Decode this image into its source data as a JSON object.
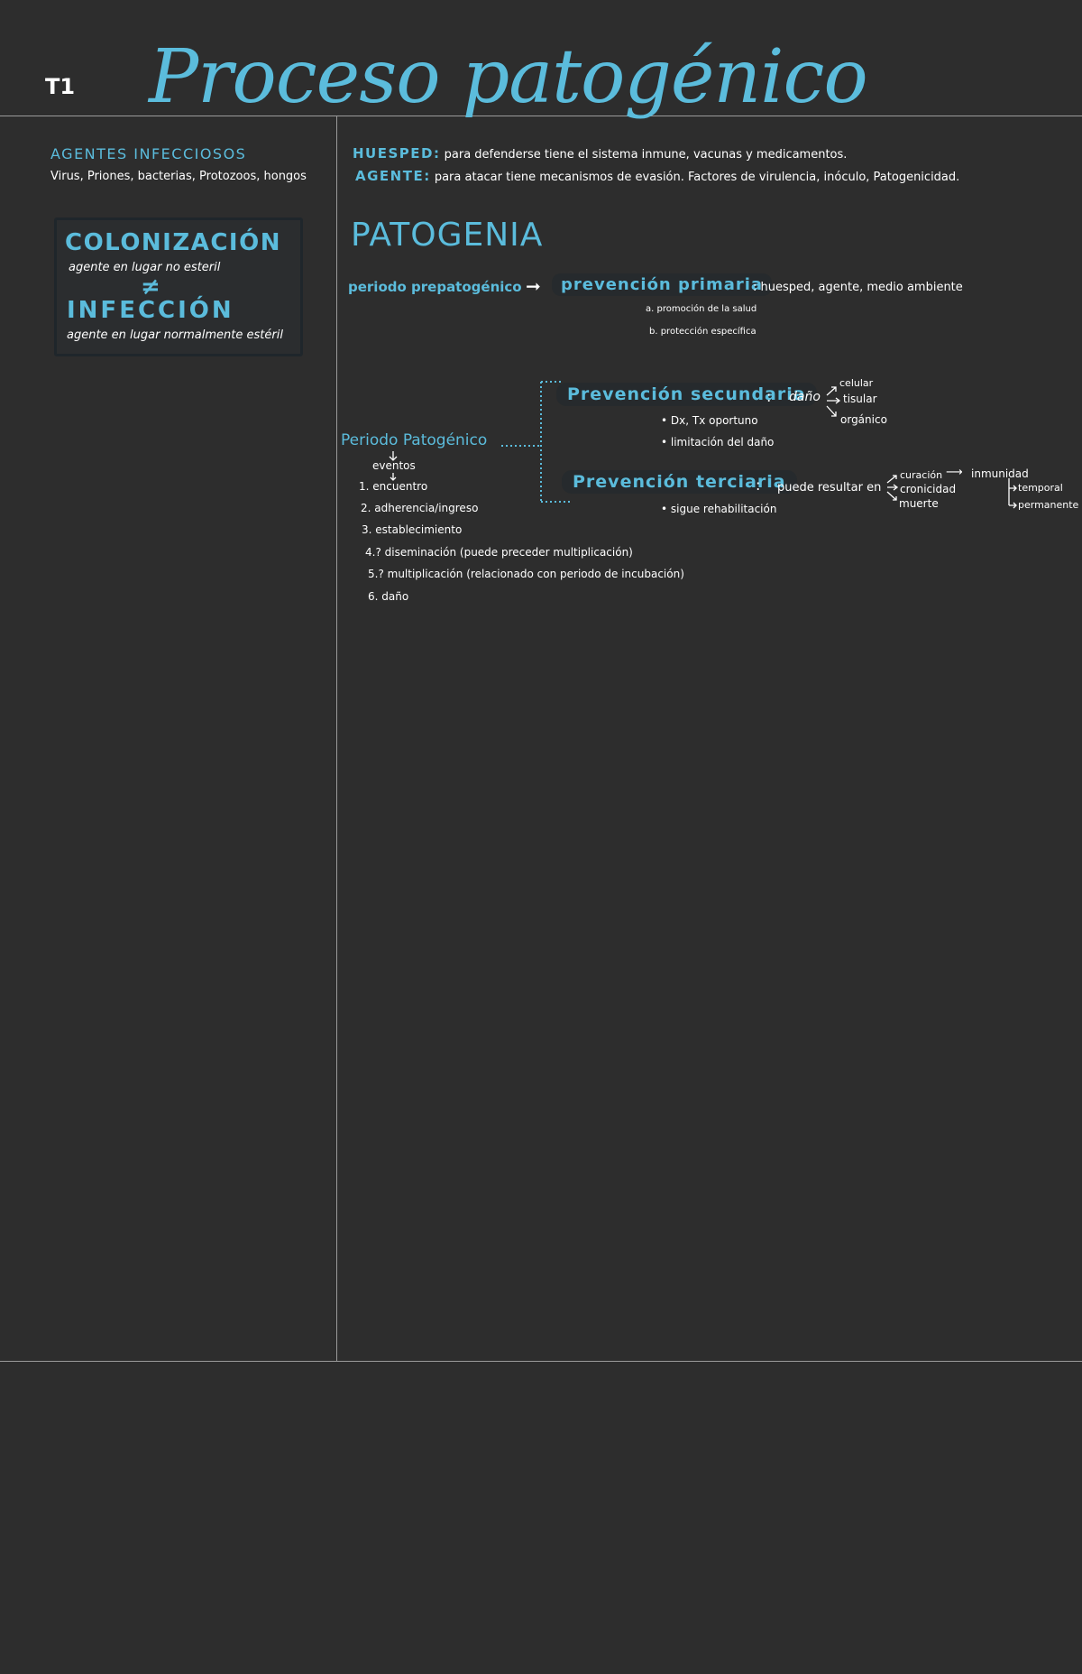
{
  "header": {
    "topic": "T1",
    "title": "Proceso patogénico"
  },
  "sidebar": {
    "agentes_heading": "AGENTES INFECCIOSOS",
    "agentes_text": "Virus, Priones, bacterias, Protozoos, hongos",
    "colonizacion_heading": "COLONIZACIÓN",
    "colonizacion_text": "agente en lugar no esteril",
    "neq_symbol": "≠",
    "infeccion_heading": "INFECCIÓN",
    "infeccion_text": "agente en lugar normalmente estéril"
  },
  "main": {
    "huesped_label": "HUESPED:",
    "huesped_text": "para defenderse tiene el sistema inmune, vacunas y medicamentos.",
    "agente_label": "AGENTE:",
    "agente_text": "para atacar tiene mecanismos de evasión. Factores de virulencia, inóculo, Patogenicidad.",
    "patogenia_heading": "PATOGENIA",
    "prepatogenico_label": "periodo prepatogénico",
    "arrow": "➞",
    "primaria_label": "prevención primaria",
    "primaria_text": ": huesped, agente, medio ambiente",
    "primaria_a": "a. promoción de la salud",
    "primaria_b": "b. protección específica",
    "secundaria_label": "Prevención secundaria",
    "secundaria_colon": ":",
    "dano_label": "daño",
    "dano_branches": [
      "celular",
      "tisular",
      "orgánico"
    ],
    "secundaria_bullets": [
      "• Dx, Tx oportuno",
      "• limitación del daño"
    ],
    "patogenico_label": "Periodo Patogénico",
    "eventos_label": "eventos",
    "steps": [
      "1. encuentro",
      "2. adherencia/ingreso",
      "3. establecimiento",
      "4.? diseminación (puede preceder multiplicación)",
      "5.? multiplicación (relacionado con periodo de incubación)",
      "6. daño"
    ],
    "terciaria_label": "Prevención terciaria",
    "terciaria_colon": ":",
    "terciaria_text": "puede resultar en",
    "terciaria_results": [
      "curación",
      "cronicidad",
      "muerte"
    ],
    "terciaria_arrow": "⟶",
    "inmunidad_label": "inmunidad",
    "inmunidad_types": [
      "temporal",
      "permanente"
    ],
    "terciaria_bullet": "• sigue rehabilitación"
  },
  "colors": {
    "background": "#2d2d2d",
    "accent": "#5bbcdc",
    "text": "#ffffff",
    "rule": "#9a9a9a"
  }
}
